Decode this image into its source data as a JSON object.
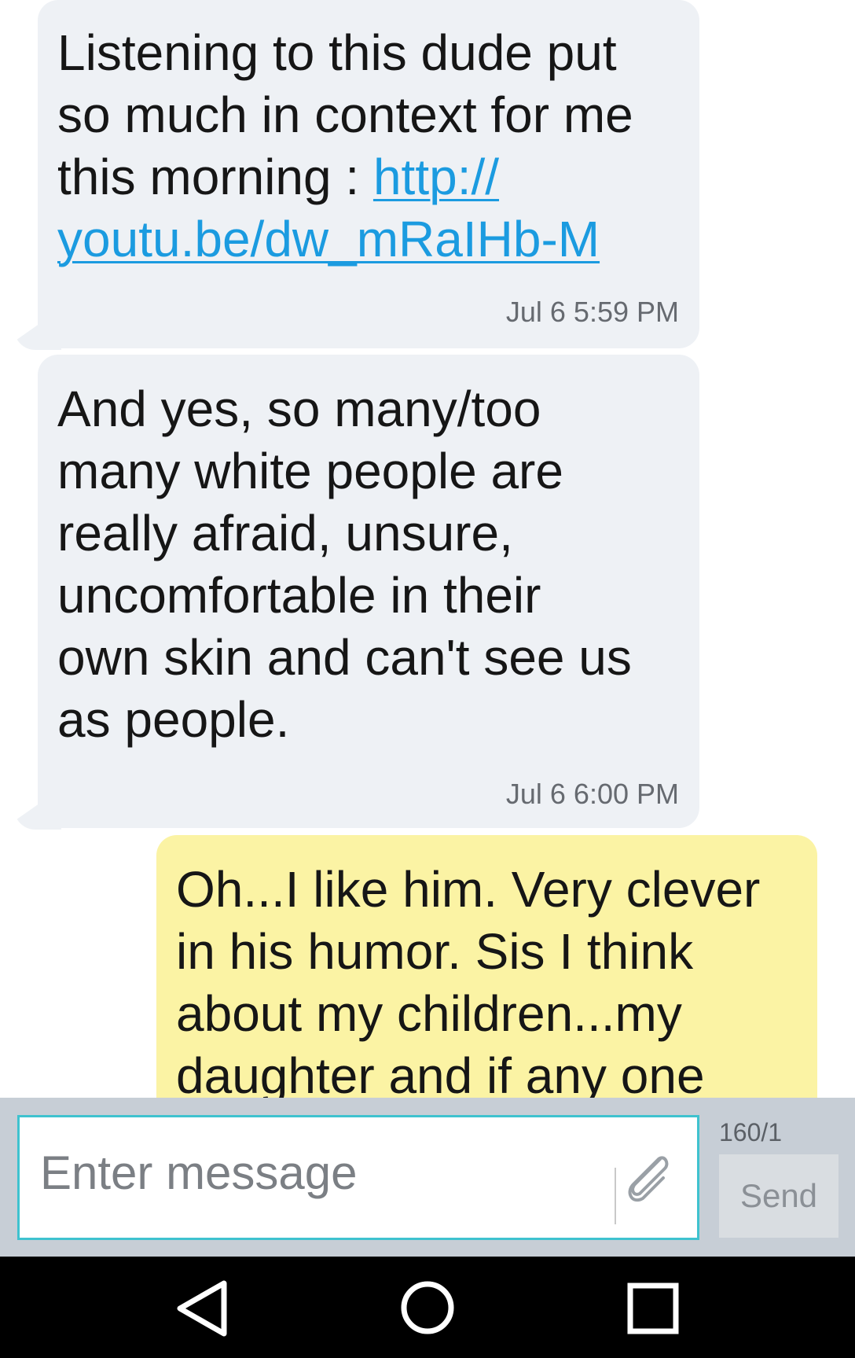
{
  "messages": [
    {
      "direction": "incoming",
      "text": "Listening to this dude put\nso much in context for me\nthis morning : ",
      "link_line1": "http://",
      "link_line2": "youtu.be/dw_mRaIHb-M",
      "timestamp": "Jul 6 5:59 PM"
    },
    {
      "direction": "incoming",
      "text": "And yes, so many/too\nmany white people are\nreally afraid, unsure,\nuncomfortable in their\nown skin and can't see us\nas people.",
      "timestamp": "Jul 6 6:00 PM"
    },
    {
      "direction": "outgoing",
      "text": "Oh...I like him. Very clever\nin his humor. Sis I think\nabout my children...my\ndaughter and if any one"
    }
  ],
  "compose": {
    "placeholder": "Enter message",
    "counter": "160/1",
    "send_label": "Send",
    "attach_icon": "paperclip-icon",
    "accent_color": "#3fc2cf"
  },
  "navbar": {
    "back_icon": "back-triangle-icon",
    "home_icon": "home-circle-icon",
    "recents_icon": "recents-square-icon"
  },
  "colors": {
    "incoming_bubble": "#eef1f5",
    "outgoing_bubble": "#fbf3a4",
    "link": "#1b9be0"
  }
}
